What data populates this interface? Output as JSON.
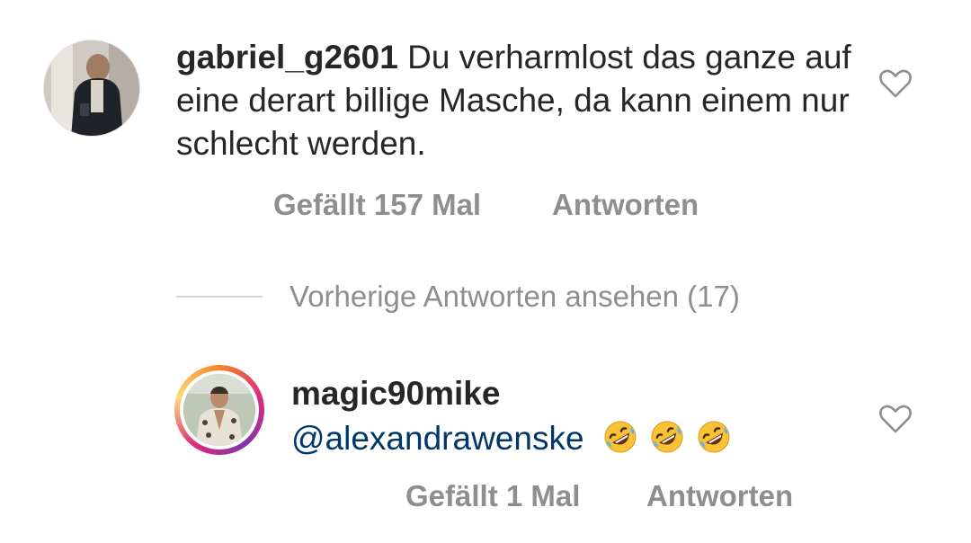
{
  "comments": [
    {
      "username": "gabriel_g2601",
      "text": "Du verharmlost das ganze auf eine derart billige Masche, da kann einem nur schlecht werden.",
      "likes_label": "Gefällt 157 Mal",
      "reply_label": "Antworten",
      "like_icon": "heart-outline-icon"
    },
    {
      "username": "magic90mike",
      "mention": "@alexandrawenske",
      "emoji_icon": "rolling-on-floor-laughing-emoji",
      "emoji_count": 3,
      "likes_label": "Gefällt 1 Mal",
      "reply_label": "Antworten",
      "like_icon": "heart-outline-icon",
      "story_ring": true
    }
  ],
  "view_replies": {
    "label": "Vorherige Antworten ansehen (17)"
  },
  "colors": {
    "text": "#262626",
    "muted": "#8e8e8e",
    "mention": "#00376b",
    "divider": "#d4d4d4"
  }
}
